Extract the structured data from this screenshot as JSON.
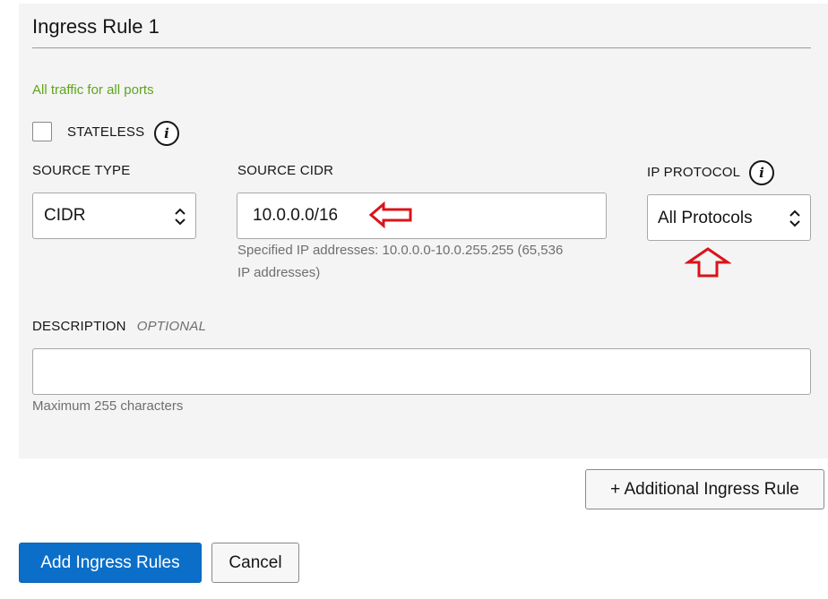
{
  "rule": {
    "title": "Ingress Rule 1",
    "note": "All traffic for all ports"
  },
  "stateless": {
    "label": "STATELESS",
    "checked": false,
    "info_icon": "info-icon"
  },
  "source_type": {
    "label": "SOURCE TYPE",
    "value": "CIDR",
    "icon": "chevron-up-down-icon"
  },
  "source_cidr": {
    "label": "SOURCE CIDR",
    "value": "10.0.0.0/16",
    "help_line1": "Specified IP addresses: 10.0.0.0-10.0.255.255 (65,536",
    "help_line2": "IP addresses)"
  },
  "ip_protocol": {
    "label": "IP PROTOCOL",
    "value": "All Protocols",
    "info_icon": "info-icon",
    "icon": "chevron-up-down-icon"
  },
  "description": {
    "label": "DESCRIPTION",
    "optional": "OPTIONAL",
    "value": "",
    "help": "Maximum 255 characters"
  },
  "buttons": {
    "additional_rule": "+ Additional Ingress Rule",
    "add_rules": "Add Ingress Rules",
    "cancel": "Cancel"
  },
  "colors": {
    "primary": "#0b6fc9",
    "note_green": "#5fa51c",
    "annotation_red": "#d9141a",
    "panel_bg": "#f4f4f4"
  }
}
